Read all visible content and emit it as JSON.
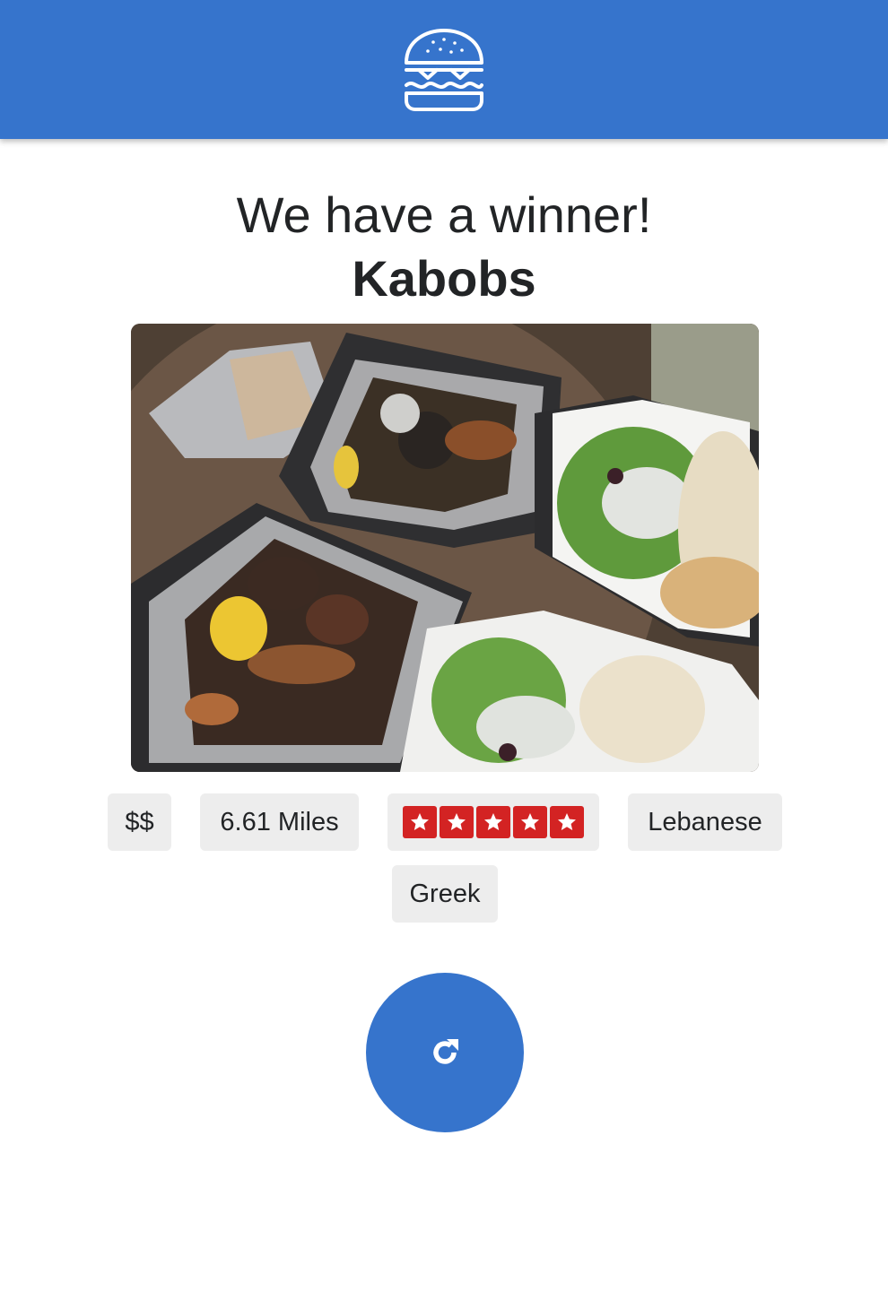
{
  "header": {
    "logo_icon": "hamburger-icon",
    "background_color": "#3674cc"
  },
  "result": {
    "headline": "We have a winner!",
    "restaurant_name": "Kabobs",
    "photo_description_icon": "food-photo",
    "tags": {
      "price": "$$",
      "distance": "6.61 Miles",
      "rating": 5,
      "rating_max": 5,
      "categories": [
        "Lebanese",
        "Greek"
      ]
    }
  },
  "actions": {
    "refresh_icon": "refresh-icon"
  },
  "colors": {
    "accent": "#3674cc",
    "star_red": "#d32323",
    "chip_bg": "#ededed"
  }
}
